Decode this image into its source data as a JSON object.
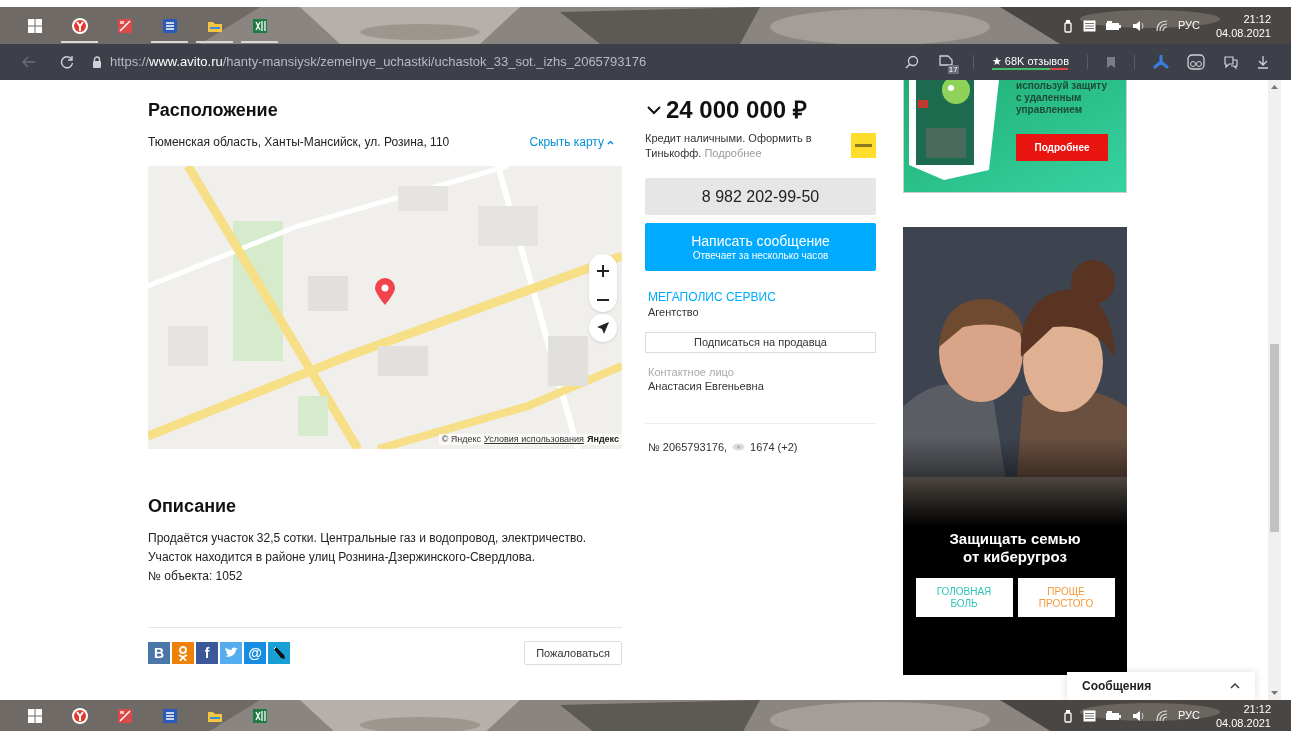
{
  "taskbar_top": {
    "apps": [
      {
        "kind": "start"
      },
      {
        "kind": "browser",
        "running": true
      },
      {
        "kind": "image_app",
        "running": false
      },
      {
        "kind": "word",
        "running": true
      },
      {
        "kind": "explorer",
        "running": true
      },
      {
        "kind": "excel",
        "running": true
      }
    ],
    "language": "РУС",
    "time": "21:12",
    "date": "04.08.2021"
  },
  "browser": {
    "url": {
      "scheme": "https://",
      "host": "www.avito.ru",
      "path": "/hanty-mansiysk/zemelnye_uchastki/uchastok_33_sot._izhs_2065793176"
    },
    "extension_badge": "17",
    "reviews": "★ 68K отзывов"
  },
  "page": {
    "location": {
      "title": "Расположение",
      "address": "Тюменская область, Ханты-Мансийск, ул. Розина, 110",
      "toggle": "Скрыть карту",
      "map": {
        "kind": "picture",
        "attribution": "© Яндекс",
        "terms": "Условия использования",
        "logo": "Яндекс"
      }
    },
    "description": {
      "title": "Описание",
      "lines": [
        "Продаётся участок 32,5 сотки. Центральные газ и водопровод, электричество.",
        "Участок находится в районе улиц Рознина-Дзержинского-Свердлова.",
        "№ объекта: 1052"
      ]
    },
    "share": [
      {
        "kind": "vk",
        "label": "В"
      },
      {
        "kind": "ok"
      },
      {
        "kind": "facebook",
        "label": "f"
      },
      {
        "kind": "twitter"
      },
      {
        "kind": "mail",
        "label": "@"
      },
      {
        "kind": "livejournal"
      }
    ],
    "complaint_button": "Пожаловаться",
    "price": "24 000 000 ₽",
    "credit": {
      "text": "Кредит наличными. Оформить в Тинькофф.",
      "link": "Подробнее"
    },
    "phone": "8 982 202-99-50",
    "message_button": {
      "title": "Написать сообщение",
      "subtitle": "Отвечает за несколько часов"
    },
    "seller": {
      "name": "МЕГАПОЛИС СЕРВИС",
      "type": "Агентство"
    },
    "subscribe_button": "Подписаться на продавца",
    "contact": {
      "label": "Контактное лицо",
      "name": "Анастасия Евгеньевна"
    },
    "item_number": "№ 2065793176,",
    "views": "1674 (+2)",
    "ads": [
      {
        "kind": "software",
        "lines": [
          "используй защиту",
          "с удаленным",
          "управлением"
        ],
        "button": "Подробнее"
      },
      {
        "kind": "family",
        "headline": [
          "Защищать семью",
          "от киберугроз"
        ],
        "buttons": [
          {
            "label": "ГОЛОВНАЯ БОЛЬ",
            "color": "#2ec4b6"
          },
          {
            "label": "ПРОЩЕ ПРОСТОГО",
            "color": "#f29a3a"
          }
        ]
      }
    ]
  },
  "messages_panel": {
    "title": "Сообщения"
  },
  "taskbar_bottom": {
    "apps": [
      {
        "kind": "start"
      },
      {
        "kind": "browser"
      },
      {
        "kind": "image_app"
      },
      {
        "kind": "word"
      },
      {
        "kind": "explorer"
      },
      {
        "kind": "excel"
      }
    ],
    "language": "РУС",
    "time": "21:12",
    "date": "04.08.2021"
  }
}
